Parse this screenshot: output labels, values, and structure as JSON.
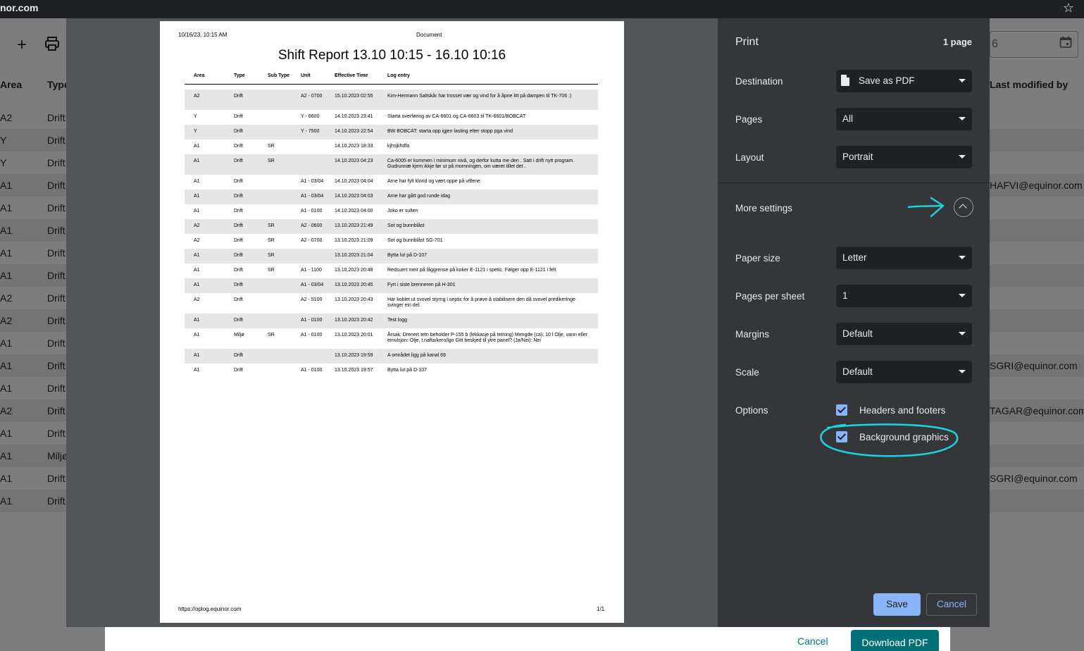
{
  "browser": {
    "url_fragment": "nor.com",
    "bookmark_icon": "star-icon"
  },
  "app": {
    "toolbar_icons": [
      "plus-icon",
      "print-icon"
    ],
    "columns": {
      "area": "Area",
      "type": "Type",
      "last_modified": "Last modified by"
    },
    "date_value": "6",
    "rows": [
      {
        "area": "A2",
        "type": "Drift",
        "modified": ""
      },
      {
        "area": "Y",
        "type": "Drift",
        "modified": ""
      },
      {
        "area": "Y",
        "type": "Drift",
        "modified": ""
      },
      {
        "area": "A1",
        "type": "Drift",
        "modified": "HAFVI@equinor.com"
      },
      {
        "area": "A1",
        "type": "Drift",
        "modified": ""
      },
      {
        "area": "A1",
        "type": "Drift",
        "modified": ""
      },
      {
        "area": "A1",
        "type": "Drift",
        "modified": ""
      },
      {
        "area": "A1",
        "type": "Drift",
        "modified": ""
      },
      {
        "area": "A2",
        "type": "Drift",
        "modified": ""
      },
      {
        "area": "A2",
        "type": "Drift",
        "modified": ""
      },
      {
        "area": "A1",
        "type": "Drift",
        "modified": ""
      },
      {
        "area": "A1",
        "type": "Drift",
        "modified": "SGRI@equinor.com"
      },
      {
        "area": "A1",
        "type": "Drift",
        "modified": ""
      },
      {
        "area": "A2",
        "type": "Drift",
        "modified": "TAGAR@equinor.com"
      },
      {
        "area": "A1",
        "type": "Drift",
        "modified": ""
      },
      {
        "area": "A1",
        "type": "Miljø",
        "modified": ""
      },
      {
        "area": "A1",
        "type": "Drift",
        "modified": "SGRI@equinor.com"
      },
      {
        "area": "A1",
        "type": "Drift",
        "modified": ""
      }
    ],
    "dialog": {
      "cancel": "Cancel",
      "download": "Download PDF"
    }
  },
  "preview": {
    "header_date": "10/16/23, 10:15 AM",
    "header_doc": "Document",
    "title": "Shift Report 13.10 10:15 - 16.10 10:16",
    "columns": [
      "Area",
      "Type",
      "Sub Type",
      "Unit",
      "Effective Time",
      "Log entry"
    ],
    "rows": [
      {
        "area": "A2",
        "type": "Drift",
        "sub": "",
        "unit": "A2 - 0700",
        "time": "15.10.2023 02:55",
        "entry": "Kim-Hermann Saltskår har trosset vær og vind for å åpne litt på dampen til TK-706 :)",
        "tall": true
      },
      {
        "area": "Y",
        "type": "Drift",
        "sub": "",
        "unit": "Y - 6600",
        "time": "14.10.2023 23:41",
        "entry": "Starta overføring av CA-6601 og CA-6603 til TK-6601/BOBCAT",
        "tall": false
      },
      {
        "area": "Y",
        "type": "Drift",
        "sub": "",
        "unit": "Y - 7500",
        "time": "14.10.2023 22:54",
        "entry": "BW BOBCAT: starta opp igjen lasting etter stopp pga vind",
        "tall": false
      },
      {
        "area": "A1",
        "type": "Drift",
        "sub": "SR",
        "unit": "",
        "time": "14.10.2023 18:33",
        "entry": "kjhsjkhdfa",
        "tall": false
      },
      {
        "area": "A1",
        "type": "Drift",
        "sub": "SR",
        "unit": "",
        "time": "14.10.2023 04:23",
        "entry": "Ca-6005 er kommen i minimum nivå, og derfor kutta me den . Satt i drift nytt program. Gudrunnæ kjem ikkje før ut på mornningen, om været tillet det .",
        "tall": true
      },
      {
        "area": "A1",
        "type": "Drift",
        "sub": "",
        "unit": "A1 - 03/04",
        "time": "14.10.2023 04:04",
        "entry": "Arne har fylt klorid og vært oppe på viftene",
        "tall": false
      },
      {
        "area": "A1",
        "type": "Drift",
        "sub": "",
        "unit": "A1 - 03/04",
        "time": "14.10.2023 04:03",
        "entry": "Arne har gått god runde idag",
        "tall": false
      },
      {
        "area": "A1",
        "type": "Drift",
        "sub": "",
        "unit": "A1 - 0100",
        "time": "14.10.2023 04:00",
        "entry": "Joko er sulten",
        "tall": false
      },
      {
        "area": "A2",
        "type": "Drift",
        "sub": "SR",
        "unit": "A2 - 0600",
        "time": "13.10.2023 21:49",
        "entry": "Sot og bunnblåst",
        "tall": false
      },
      {
        "area": "A2",
        "type": "Drift",
        "sub": "SR",
        "unit": "A2 - 0700",
        "time": "13.10.2023 21:09",
        "entry": "Sot og bunnblåst SG-701",
        "tall": false
      },
      {
        "area": "A1",
        "type": "Drift",
        "sub": "SR",
        "unit": "",
        "time": "13.10.2023 21:04",
        "entry": "Bytta lut på D-107",
        "tall": false
      },
      {
        "area": "A1",
        "type": "Drift",
        "sub": "SR",
        "unit": "A1 - 1100",
        "time": "13.10.2023 20:48",
        "entry": "Redsuert meir på låggrense på koker E-1121 i spetic. Følger opp E-1121 i felt",
        "tall": false
      },
      {
        "area": "A1",
        "type": "Drift",
        "sub": "",
        "unit": "A1 - 03/04",
        "time": "13.10.2023 20:45",
        "entry": "Fyrt i siste brenneren på H-301",
        "tall": false
      },
      {
        "area": "A2",
        "type": "Drift",
        "sub": "",
        "unit": "A2 - 5100",
        "time": "13.10.2023 20:43",
        "entry": "Har koblet ut svovel styrng i septic for å prøve å stabilisere den då svovel predikeringe svinger ein del.",
        "tall": true
      },
      {
        "area": "A1",
        "type": "Drift",
        "sub": "",
        "unit": "A1 - 0100",
        "time": "13.10.2023 20:42",
        "entry": "Test logg",
        "tall": false
      },
      {
        "area": "A1",
        "type": "Miljø",
        "sub": "SR",
        "unit": "A1 - 0100",
        "time": "13.10.2023 20:01",
        "entry": "Årsak: Drenert tetn beholder P-155 b (lekkasje på tetning) Mengde (ca): 10 l Olje, vann eller emulsjon: Olje, t.nafta/kero/lgo Gitt beskjed til ytre panel? (Ja/Nei): Nei",
        "tall": true
      },
      {
        "area": "A1",
        "type": "Drift",
        "sub": "",
        "unit": "",
        "time": "13.10.2023 19:59",
        "entry": "A området ligg på kanal 69",
        "tall": false
      },
      {
        "area": "A1",
        "type": "Drift",
        "sub": "",
        "unit": "A1 - 0100",
        "time": "13.10.2023 19:57",
        "entry": "Bytta lut på D-107",
        "tall": false
      }
    ],
    "footer_url": "https://oplog.equinor.com",
    "footer_page": "1/1"
  },
  "settings": {
    "title": "Print",
    "page_count": "1 page",
    "destination": {
      "label": "Destination",
      "value": "Save as PDF"
    },
    "pages": {
      "label": "Pages",
      "value": "All"
    },
    "layout": {
      "label": "Layout",
      "value": "Portrait"
    },
    "more": {
      "label": "More settings",
      "icon": "chevron-up-icon"
    },
    "paper_size": {
      "label": "Paper size",
      "value": "Letter"
    },
    "pages_per_sheet": {
      "label": "Pages per sheet",
      "value": "1"
    },
    "margins": {
      "label": "Margins",
      "value": "Default"
    },
    "scale": {
      "label": "Scale",
      "value": "Default"
    },
    "options": {
      "label": "Options",
      "headers_footers": "Headers and footers",
      "background_graphics": "Background graphics"
    },
    "save": "Save",
    "cancel": "Cancel"
  },
  "colors": {
    "accent": "#8ab4f8",
    "panel": "#35363a",
    "annotation": "#19d3e0",
    "brand": "#006f77"
  }
}
